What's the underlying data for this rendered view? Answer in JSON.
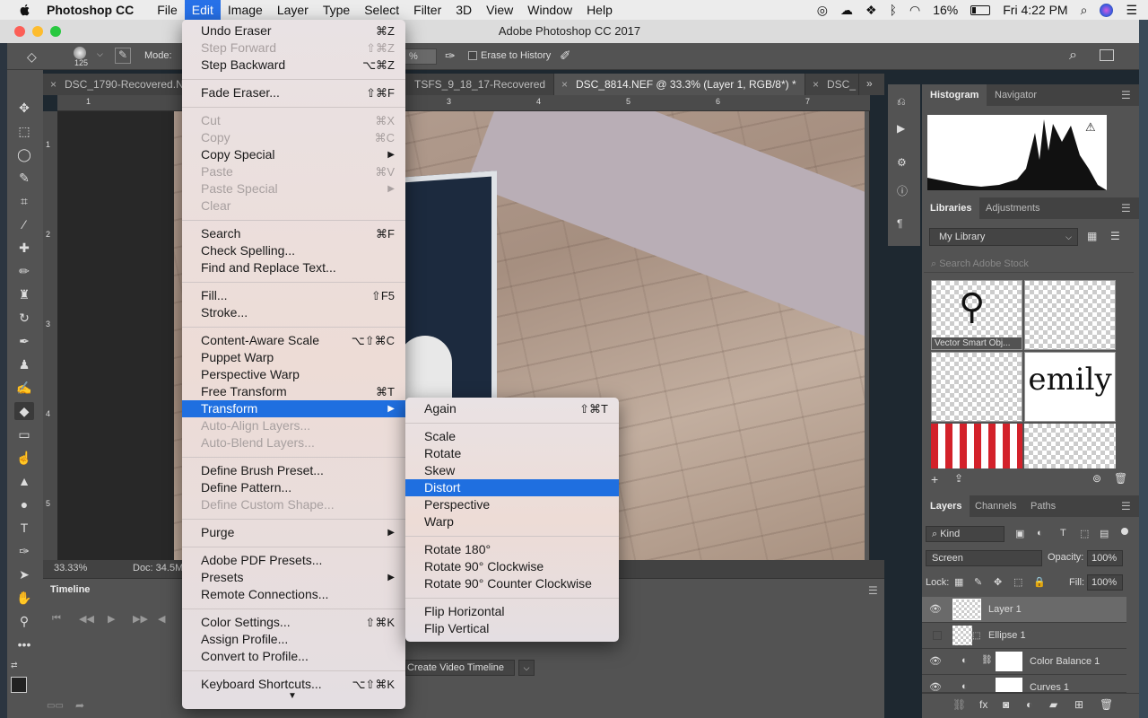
{
  "menubar": {
    "app_name": "Photoshop CC",
    "items": [
      "File",
      "Edit",
      "Image",
      "Layer",
      "Type",
      "Select",
      "Filter",
      "3D",
      "View",
      "Window",
      "Help"
    ],
    "battery": "16%",
    "clock": "Fri 4:22 PM"
  },
  "window": {
    "title": "Adobe Photoshop CC 2017"
  },
  "options": {
    "brush_size": "125",
    "mode_label": "Mode:",
    "opacity_fragment": "%",
    "erase_to_history": "Erase to History"
  },
  "tabs": [
    {
      "label": "DSC_1790-Recovered.N"
    },
    {
      "label": "TSFS_9_18_17-Recovered"
    },
    {
      "label": "DSC_8814.NEF @ 33.3% (Layer 1, RGB/8*) *"
    },
    {
      "label": "DSC_"
    }
  ],
  "rulers": {
    "top": [
      "1",
      "3",
      "4",
      "5",
      "6",
      "7"
    ],
    "left": [
      "1",
      "2",
      "3",
      "4",
      "5"
    ]
  },
  "status": {
    "zoom": "33.33%",
    "doc": "Doc: 34.5M"
  },
  "timeline": {
    "title": "Timeline",
    "create_button": "Create Video Timeline"
  },
  "edit_menu": [
    {
      "label": "Undo Eraser",
      "shortcut": "⌘Z",
      "enabled": true
    },
    {
      "label": "Step Forward",
      "shortcut": "⇧⌘Z",
      "enabled": false
    },
    {
      "label": "Step Backward",
      "shortcut": "⌥⌘Z",
      "enabled": true
    },
    {
      "sep": true
    },
    {
      "label": "Fade Eraser...",
      "shortcut": "⇧⌘F",
      "enabled": true
    },
    {
      "sep": true
    },
    {
      "label": "Cut",
      "shortcut": "⌘X",
      "enabled": false
    },
    {
      "label": "Copy",
      "shortcut": "⌘C",
      "enabled": false
    },
    {
      "label": "Copy Special",
      "shortcut": "",
      "submenu": true,
      "enabled": true
    },
    {
      "label": "Paste",
      "shortcut": "⌘V",
      "enabled": false
    },
    {
      "label": "Paste Special",
      "shortcut": "",
      "submenu": true,
      "enabled": false
    },
    {
      "label": "Clear",
      "shortcut": "",
      "enabled": false
    },
    {
      "sep": true
    },
    {
      "label": "Search",
      "shortcut": "⌘F",
      "enabled": true
    },
    {
      "label": "Check Spelling...",
      "shortcut": "",
      "enabled": true
    },
    {
      "label": "Find and Replace Text...",
      "shortcut": "",
      "enabled": true
    },
    {
      "sep": true
    },
    {
      "label": "Fill...",
      "shortcut": "⇧F5",
      "enabled": true
    },
    {
      "label": "Stroke...",
      "shortcut": "",
      "enabled": true
    },
    {
      "sep": true
    },
    {
      "label": "Content-Aware Scale",
      "shortcut": "⌥⇧⌘C",
      "enabled": true
    },
    {
      "label": "Puppet Warp",
      "shortcut": "",
      "enabled": true
    },
    {
      "label": "Perspective Warp",
      "shortcut": "",
      "enabled": true
    },
    {
      "label": "Free Transform",
      "shortcut": "⌘T",
      "enabled": true
    },
    {
      "label": "Transform",
      "shortcut": "",
      "submenu": true,
      "enabled": true,
      "highlighted": true
    },
    {
      "label": "Auto-Align Layers...",
      "shortcut": "",
      "enabled": false
    },
    {
      "label": "Auto-Blend Layers...",
      "shortcut": "",
      "enabled": false
    },
    {
      "sep": true
    },
    {
      "label": "Define Brush Preset...",
      "shortcut": "",
      "enabled": true
    },
    {
      "label": "Define Pattern...",
      "shortcut": "",
      "enabled": true
    },
    {
      "label": "Define Custom Shape...",
      "shortcut": "",
      "enabled": false
    },
    {
      "sep": true
    },
    {
      "label": "Purge",
      "shortcut": "",
      "submenu": true,
      "enabled": true
    },
    {
      "sep": true
    },
    {
      "label": "Adobe PDF Presets...",
      "shortcut": "",
      "enabled": true
    },
    {
      "label": "Presets",
      "shortcut": "",
      "submenu": true,
      "enabled": true
    },
    {
      "label": "Remote Connections...",
      "shortcut": "",
      "enabled": true
    },
    {
      "sep": true
    },
    {
      "label": "Color Settings...",
      "shortcut": "⇧⌘K",
      "enabled": true
    },
    {
      "label": "Assign Profile...",
      "shortcut": "",
      "enabled": true
    },
    {
      "label": "Convert to Profile...",
      "shortcut": "",
      "enabled": true
    },
    {
      "sep": true
    },
    {
      "label": "Keyboard Shortcuts...",
      "shortcut": "⌥⇧⌘K",
      "enabled": true
    }
  ],
  "transform_menu": [
    {
      "label": "Again",
      "shortcut": "⇧⌘T"
    },
    {
      "sep": true
    },
    {
      "label": "Scale"
    },
    {
      "label": "Rotate"
    },
    {
      "label": "Skew"
    },
    {
      "label": "Distort",
      "highlighted": true
    },
    {
      "label": "Perspective"
    },
    {
      "label": "Warp"
    },
    {
      "sep": true
    },
    {
      "label": "Rotate 180°"
    },
    {
      "label": "Rotate 90° Clockwise"
    },
    {
      "label": "Rotate 90° Counter Clockwise"
    },
    {
      "sep": true
    },
    {
      "label": "Flip Horizontal"
    },
    {
      "label": "Flip Vertical"
    }
  ],
  "panels": {
    "histogram_tabs": [
      "Histogram",
      "Navigator"
    ],
    "library_tabs": [
      "Libraries",
      "Adjustments"
    ],
    "library_select": "My Library",
    "stock_search_placeholder": "Search Adobe Stock",
    "library_items": [
      {
        "caption": "Vector Smart Obj..."
      },
      {
        "caption": ""
      },
      {
        "caption": ""
      },
      {
        "caption": ""
      },
      {
        "caption": ""
      },
      {
        "caption": ""
      }
    ],
    "layers_tabs": [
      "Layers",
      "Channels",
      "Paths"
    ],
    "kind_filter": "Kind",
    "blend_mode": "Screen",
    "opacity_label": "Opacity:",
    "opacity_value": "100%",
    "lock_label": "Lock:",
    "fill_label": "Fill:",
    "fill_value": "100%",
    "layers": [
      {
        "name": "Layer 1",
        "visible": true
      },
      {
        "name": "Ellipse 1",
        "visible": false
      },
      {
        "name": "Color Balance 1",
        "visible": true
      },
      {
        "name": "Curves 1",
        "visible": true
      }
    ]
  },
  "colors": {
    "menu_highlight": "#1f6fe0",
    "panel_bg": "#535353"
  }
}
